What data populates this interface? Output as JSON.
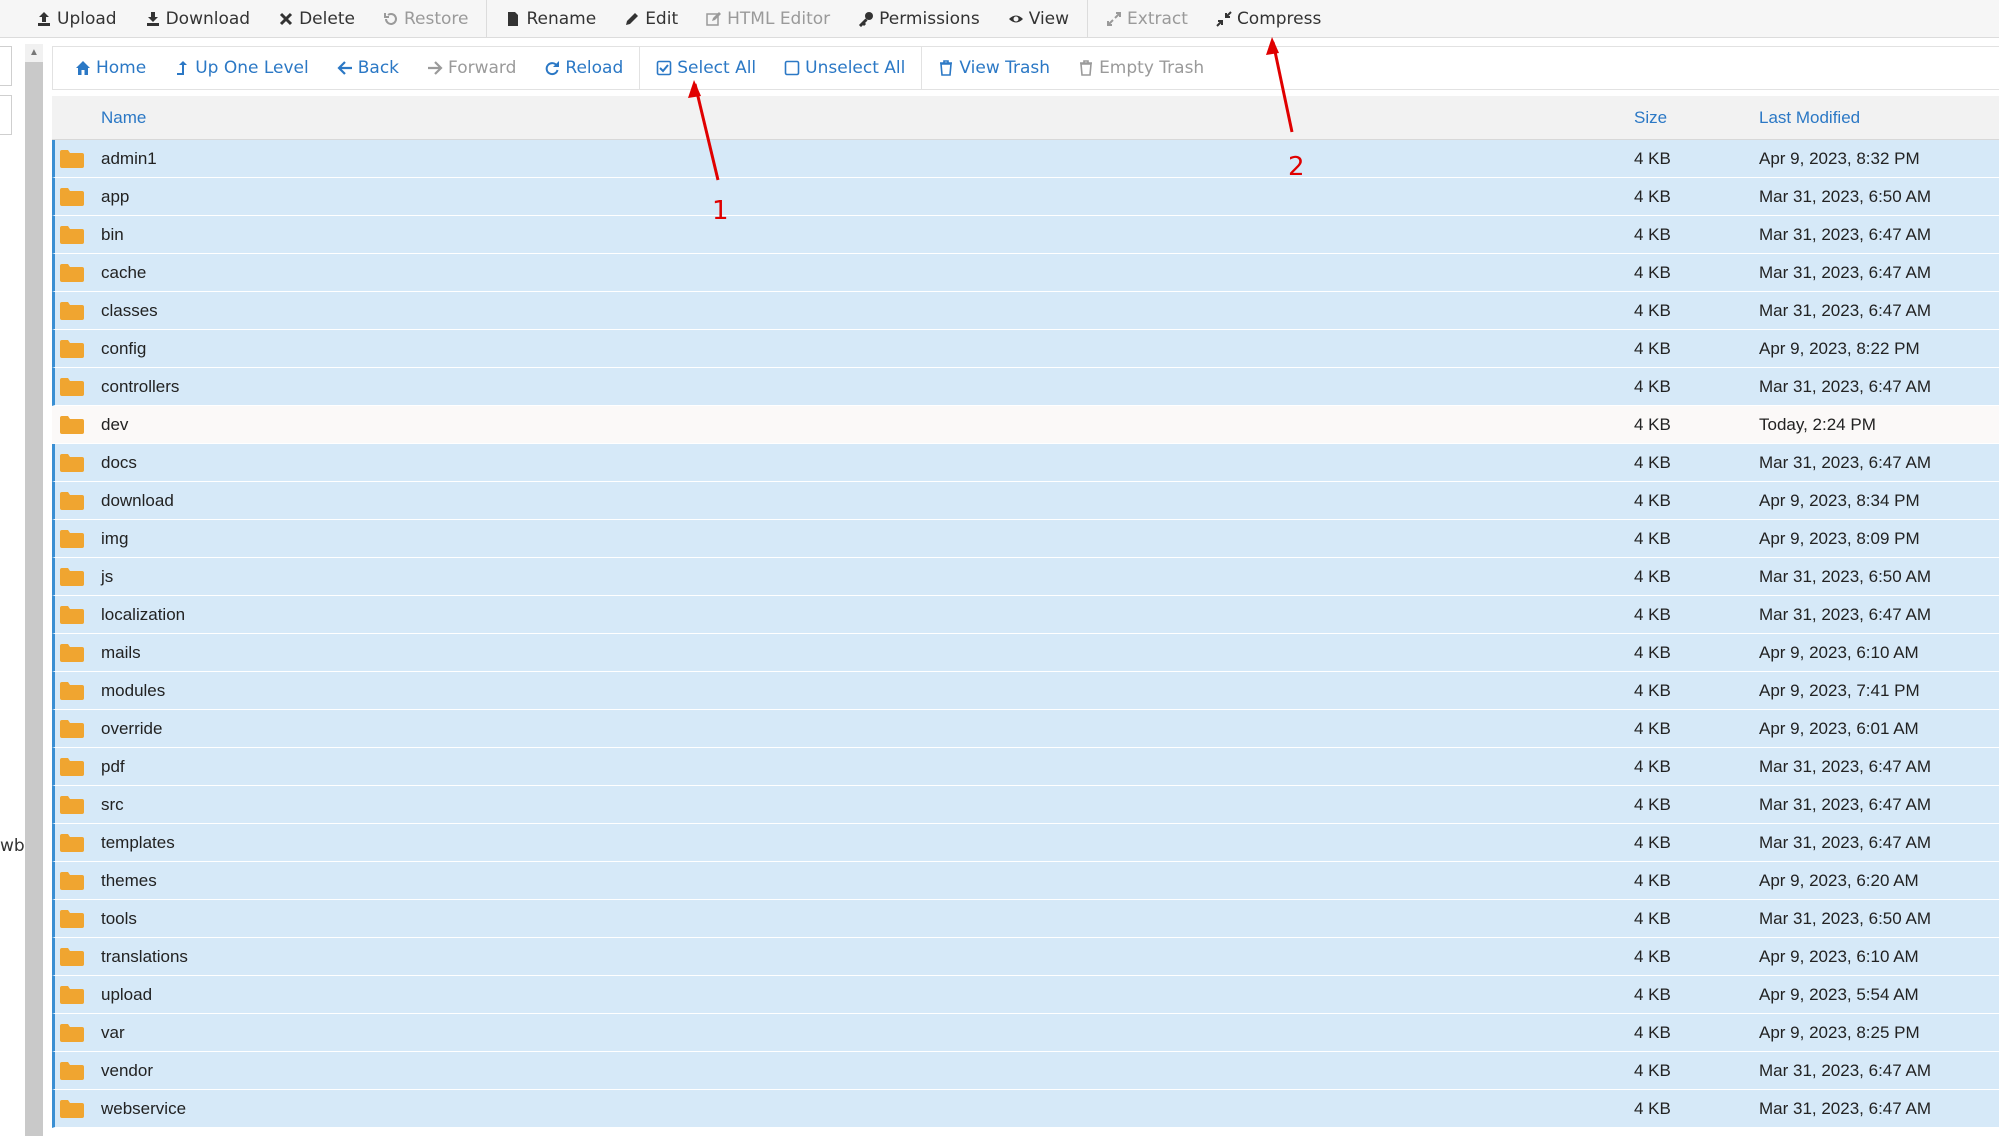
{
  "toolbar": {
    "items": [
      {
        "label": "Upload",
        "icon": "upload-icon",
        "disabled": false
      },
      {
        "label": "Download",
        "icon": "download-icon",
        "disabled": false
      },
      {
        "label": "Delete",
        "icon": "delete-icon",
        "disabled": false
      },
      {
        "label": "Restore",
        "icon": "restore-icon",
        "disabled": true
      },
      {
        "label": "Rename",
        "icon": "file-icon",
        "disabled": false
      },
      {
        "label": "Edit",
        "icon": "pencil-icon",
        "disabled": false
      },
      {
        "label": "HTML Editor",
        "icon": "edit-square-icon",
        "disabled": true
      },
      {
        "label": "Permissions",
        "icon": "key-icon",
        "disabled": false
      },
      {
        "label": "View",
        "icon": "eye-icon",
        "disabled": false
      },
      {
        "label": "Extract",
        "icon": "expand-icon",
        "disabled": true
      },
      {
        "label": "Compress",
        "icon": "compress-icon",
        "disabled": false
      }
    ]
  },
  "nav": {
    "items": [
      {
        "label": "Home",
        "icon": "home-icon",
        "disabled": false
      },
      {
        "label": "Up One Level",
        "icon": "level-up-icon",
        "disabled": false
      },
      {
        "label": "Back",
        "icon": "arrow-left-icon",
        "disabled": false
      },
      {
        "label": "Forward",
        "icon": "arrow-right-icon",
        "disabled": true
      },
      {
        "label": "Reload",
        "icon": "reload-icon",
        "disabled": false
      },
      {
        "label": "Select All",
        "icon": "checkbox-checked-icon",
        "disabled": false
      },
      {
        "label": "Unselect All",
        "icon": "checkbox-empty-icon",
        "disabled": false
      },
      {
        "label": "View Trash",
        "icon": "trash-icon",
        "disabled": false
      },
      {
        "label": "Empty Trash",
        "icon": "trash-icon",
        "disabled": true
      }
    ]
  },
  "left": {
    "truncated_text": "wb"
  },
  "table": {
    "headers": {
      "name": "Name",
      "size": "Size",
      "modified": "Last Modified"
    },
    "rows": [
      {
        "name": "admin1",
        "size": "4 KB",
        "modified": "Apr 9, 2023, 8:32 PM",
        "selected": true
      },
      {
        "name": "app",
        "size": "4 KB",
        "modified": "Mar 31, 2023, 6:50 AM",
        "selected": true
      },
      {
        "name": "bin",
        "size": "4 KB",
        "modified": "Mar 31, 2023, 6:47 AM",
        "selected": true
      },
      {
        "name": "cache",
        "size": "4 KB",
        "modified": "Mar 31, 2023, 6:47 AM",
        "selected": true
      },
      {
        "name": "classes",
        "size": "4 KB",
        "modified": "Mar 31, 2023, 6:47 AM",
        "selected": true
      },
      {
        "name": "config",
        "size": "4 KB",
        "modified": "Apr 9, 2023, 8:22 PM",
        "selected": true
      },
      {
        "name": "controllers",
        "size": "4 KB",
        "modified": "Mar 31, 2023, 6:47 AM",
        "selected": true
      },
      {
        "name": "dev",
        "size": "4 KB",
        "modified": "Today, 2:24 PM",
        "selected": false
      },
      {
        "name": "docs",
        "size": "4 KB",
        "modified": "Mar 31, 2023, 6:47 AM",
        "selected": true
      },
      {
        "name": "download",
        "size": "4 KB",
        "modified": "Apr 9, 2023, 8:34 PM",
        "selected": true
      },
      {
        "name": "img",
        "size": "4 KB",
        "modified": "Apr 9, 2023, 8:09 PM",
        "selected": true
      },
      {
        "name": "js",
        "size": "4 KB",
        "modified": "Mar 31, 2023, 6:50 AM",
        "selected": true
      },
      {
        "name": "localization",
        "size": "4 KB",
        "modified": "Mar 31, 2023, 6:47 AM",
        "selected": true
      },
      {
        "name": "mails",
        "size": "4 KB",
        "modified": "Apr 9, 2023, 6:10 AM",
        "selected": true
      },
      {
        "name": "modules",
        "size": "4 KB",
        "modified": "Apr 9, 2023, 7:41 PM",
        "selected": true
      },
      {
        "name": "override",
        "size": "4 KB",
        "modified": "Apr 9, 2023, 6:01 AM",
        "selected": true
      },
      {
        "name": "pdf",
        "size": "4 KB",
        "modified": "Mar 31, 2023, 6:47 AM",
        "selected": true
      },
      {
        "name": "src",
        "size": "4 KB",
        "modified": "Mar 31, 2023, 6:47 AM",
        "selected": true
      },
      {
        "name": "templates",
        "size": "4 KB",
        "modified": "Mar 31, 2023, 6:47 AM",
        "selected": true
      },
      {
        "name": "themes",
        "size": "4 KB",
        "modified": "Apr 9, 2023, 6:20 AM",
        "selected": true
      },
      {
        "name": "tools",
        "size": "4 KB",
        "modified": "Mar 31, 2023, 6:50 AM",
        "selected": true
      },
      {
        "name": "translations",
        "size": "4 KB",
        "modified": "Apr 9, 2023, 6:10 AM",
        "selected": true
      },
      {
        "name": "upload",
        "size": "4 KB",
        "modified": "Apr 9, 2023, 5:54 AM",
        "selected": true
      },
      {
        "name": "var",
        "size": "4 KB",
        "modified": "Apr 9, 2023, 8:25 PM",
        "selected": true
      },
      {
        "name": "vendor",
        "size": "4 KB",
        "modified": "Mar 31, 2023, 6:47 AM",
        "selected": true
      },
      {
        "name": "webservice",
        "size": "4 KB",
        "modified": "Mar 31, 2023, 6:47 AM",
        "selected": true
      }
    ]
  },
  "annotations": {
    "label_1": "1",
    "label_2": "2",
    "color": "#e00000"
  },
  "colors": {
    "link": "#2b78c5",
    "selected_row": "#d6e9f8",
    "folder": "#f0a530"
  }
}
